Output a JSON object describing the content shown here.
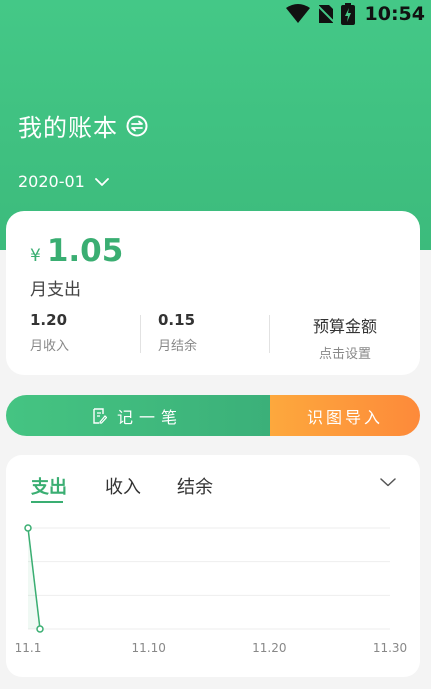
{
  "status_bar": {
    "time": "10:54"
  },
  "header": {
    "title": "我的账本",
    "month": "2020-01"
  },
  "summary": {
    "currency": "¥",
    "expense_amount": "1.05",
    "expense_label": "月支出",
    "income_value": "1.20",
    "income_label": "月收入",
    "balance_value": "0.15",
    "balance_label": "月结余",
    "budget_title": "预算金额",
    "budget_subtitle": "点击设置"
  },
  "actions": {
    "record_label": "记一笔",
    "scan_label": "识图导入"
  },
  "chart_tabs": [
    "支出",
    "收入",
    "结余"
  ],
  "chart_data": {
    "type": "line",
    "x": [
      "11.1",
      "11.2"
    ],
    "series": [
      {
        "values": [
          1.05,
          0
        ]
      }
    ],
    "x_ticks": [
      "11.1",
      "11.10",
      "11.20",
      "11.30"
    ],
    "grid": true,
    "color": "#3aae72"
  },
  "colors": {
    "accent": "#3aae72",
    "orange": "#fd8a3a"
  }
}
